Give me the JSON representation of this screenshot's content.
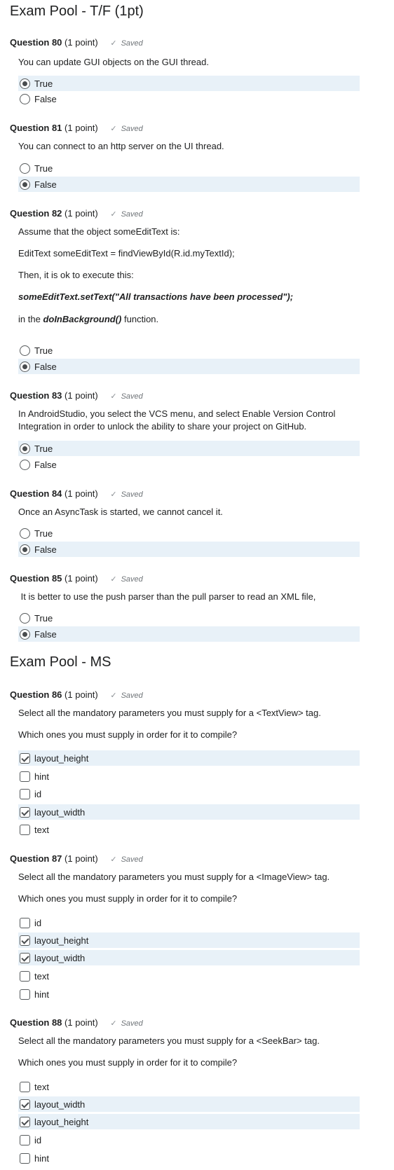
{
  "sections": [
    {
      "title": "Exam Pool - T/F (1pt)"
    },
    {
      "title": "Exam Pool - MS"
    }
  ],
  "saved_label": "Saved",
  "questions": [
    {
      "number": "Question 80",
      "points": "(1 point)",
      "text": [
        "You can update GUI objects on the GUI thread."
      ],
      "options": [
        {
          "label": "True",
          "selected": true
        },
        {
          "label": "False",
          "selected": false
        }
      ]
    },
    {
      "number": "Question 81",
      "points": "(1 point)",
      "text": [
        "You can connect to an http server on the UI thread."
      ],
      "options": [
        {
          "label": "True",
          "selected": false
        },
        {
          "label": "False",
          "selected": true
        }
      ]
    },
    {
      "number": "Question 82",
      "points": "(1 point)",
      "text": [
        "Assume that the object someEditText is:",
        "EditText someEditText = findViewById(R.id.myTextId);",
        "Then, it is ok to execute this:",
        "someEditText.setText(\"All transactions have been processed\");",
        "in the",
        "doInBackground()",
        "function."
      ],
      "options": [
        {
          "label": "True",
          "selected": false
        },
        {
          "label": "False",
          "selected": true
        }
      ]
    },
    {
      "number": "Question 83",
      "points": "(1 point)",
      "text": [
        "In AndroidStudio, you select the VCS menu, and select Enable Version Control Integration in order to unlock the ability to share your project on GitHub."
      ],
      "options": [
        {
          "label": "True",
          "selected": true
        },
        {
          "label": "False",
          "selected": false
        }
      ]
    },
    {
      "number": "Question 84",
      "points": "(1 point)",
      "text": [
        "Once an AsyncTask is started, we cannot cancel it."
      ],
      "options": [
        {
          "label": "True",
          "selected": false
        },
        {
          "label": "False",
          "selected": true
        }
      ]
    },
    {
      "number": "Question 85",
      "points": "(1 point)",
      "text": [
        " It is better to use the push parser than the pull parser to read an XML file,"
      ],
      "options": [
        {
          "label": "True",
          "selected": false
        },
        {
          "label": "False",
          "selected": true
        }
      ]
    },
    {
      "number": "Question 86",
      "points": "(1 point)",
      "text": [
        "Select all the mandatory parameters you must supply for a <TextView> tag.",
        "Which ones you must supply in order for it to compile?"
      ],
      "options": [
        {
          "label": "layout_height",
          "selected": true
        },
        {
          "label": "hint",
          "selected": false
        },
        {
          "label": "id",
          "selected": false
        },
        {
          "label": "layout_width",
          "selected": true
        },
        {
          "label": "text",
          "selected": false
        }
      ]
    },
    {
      "number": "Question 87",
      "points": "(1 point)",
      "text": [
        "Select all the mandatory parameters you must supply for a <ImageView> tag.",
        "Which ones you must supply in order for it to compile?"
      ],
      "options": [
        {
          "label": "id",
          "selected": false
        },
        {
          "label": "layout_height",
          "selected": true
        },
        {
          "label": "layout_width",
          "selected": true
        },
        {
          "label": "text",
          "selected": false
        },
        {
          "label": "hint",
          "selected": false
        }
      ]
    },
    {
      "number": "Question 88",
      "points": "(1 point)",
      "text": [
        "Select all the mandatory parameters you must supply for a <SeekBar> tag.",
        "Which ones you must supply in order for it to compile?"
      ],
      "options": [
        {
          "label": "text",
          "selected": false
        },
        {
          "label": "layout_width",
          "selected": true
        },
        {
          "label": "layout_height",
          "selected": true
        },
        {
          "label": "id",
          "selected": false
        },
        {
          "label": "hint",
          "selected": false
        }
      ]
    }
  ]
}
